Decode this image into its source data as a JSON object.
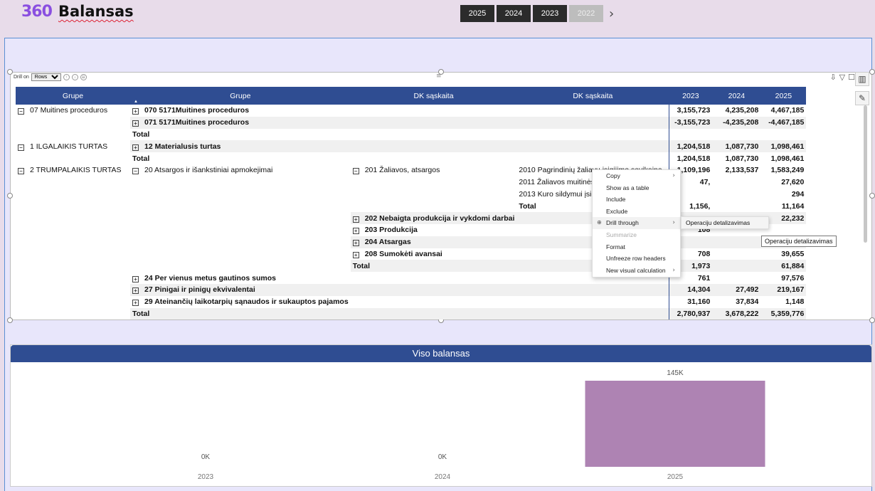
{
  "header": {
    "logo": "360",
    "title": "Balansas",
    "years": [
      {
        "label": "2025",
        "state": "active"
      },
      {
        "label": "2024",
        "state": "active"
      },
      {
        "label": "2023",
        "state": "active"
      },
      {
        "label": "2022",
        "state": "disabled"
      }
    ]
  },
  "drill": {
    "label": "Drill on",
    "value": "Rows"
  },
  "matrix": {
    "columns": [
      "Grupe",
      "Grupe",
      "DK sąskaita",
      "DK sąskaita",
      "2023",
      "2024",
      "2025"
    ],
    "rows": [
      {
        "c1": "07 Muitines proceduros",
        "c1pm": "−",
        "c2": "070 5171Muitines proceduros",
        "c2pm": "+",
        "c2b": true,
        "c3": "",
        "c4": "",
        "v1": "3,155,723",
        "v2": "4,235,208",
        "v3": "4,467,185",
        "band": false
      },
      {
        "c1": "",
        "c2": "071 5171Muitines proceduros",
        "c2pm": "+",
        "c2b": true,
        "c3": "",
        "c4": "",
        "v1": "-3,155,723",
        "v2": "-4,235,208",
        "v3": "-4,467,185",
        "band": true
      },
      {
        "c1": "",
        "c2": "Total",
        "c2b": true,
        "c3": "",
        "c4": "",
        "v1": "",
        "v2": "",
        "v3": "",
        "band": false
      },
      {
        "c1": "1 ILGALAIKIS TURTAS",
        "c1pm": "−",
        "c2": "12 Materialusis turtas",
        "c2pm": "+",
        "c2b": true,
        "c3": "",
        "c4": "",
        "v1": "1,204,518",
        "v2": "1,087,730",
        "v3": "1,098,461",
        "band": true
      },
      {
        "c1": "",
        "c2": "Total",
        "c2b": true,
        "c3": "",
        "c4": "",
        "v1": "1,204,518",
        "v2": "1,087,730",
        "v3": "1,098,461",
        "band": false
      },
      {
        "c1": "2 TRUMPALAIKIS TURTAS",
        "c1pm": "−",
        "c2": "20 Atsargos ir išankstiniai apmokejimai",
        "c2pm": "−",
        "c2b": false,
        "c3": "201 Žaliavos, atsargos",
        "c3pm": "−",
        "c4": "2010 Pagrindinių žaliavų įsigijimo savikaina",
        "v1": "1,109,196",
        "v2": "2,133,537",
        "v3": "1,583,249",
        "band": false,
        "c4band": true
      },
      {
        "c1": "",
        "c2": "",
        "c3": "",
        "c4": "2011 Žaliavos muitinės sandelis",
        "v1": "47,",
        "v2": "",
        "v3": "27,620",
        "band": false
      },
      {
        "c1": "",
        "c2": "",
        "c3": "",
        "c4": "2013 Kuro sildymui įsigyjimo savikaina",
        "v1": "",
        "v2": "",
        "v3": "294",
        "band": false,
        "c4band": true
      },
      {
        "c1": "",
        "c2": "",
        "c3": "",
        "c4": "Total",
        "c4b": true,
        "v1": "1,156,",
        "v2": "",
        "v3": "11,164",
        "band": false
      },
      {
        "c1": "",
        "c2": "",
        "c3": "202 Nebaigta produkcija ir vykdomi darbai",
        "c3pm": "+",
        "c3b": true,
        "c4": "",
        "v1": "",
        "v2": "",
        "v3": "22,232",
        "band": true
      },
      {
        "c1": "",
        "c2": "",
        "c3": "203 Produkcija",
        "c3pm": "+",
        "c3b": true,
        "c4": "",
        "v1": "108",
        "v2": "",
        "v3": "",
        "band": false
      },
      {
        "c1": "",
        "c2": "",
        "c3": "204 Atsargas",
        "c3pm": "+",
        "c3b": true,
        "c4": "",
        "v1": "",
        "v2": "",
        "v3": "215",
        "band": true
      },
      {
        "c1": "",
        "c2": "",
        "c3": "208 Sumokėti avansai",
        "c3pm": "+",
        "c3b": true,
        "c4": "",
        "v1": "708",
        "v2": "",
        "v3": "39,655",
        "band": false
      },
      {
        "c1": "",
        "c2": "",
        "c3": "Total",
        "c3b": true,
        "c4": "",
        "v1": "1,973",
        "v2": "",
        "v3": "61,884",
        "band": true
      },
      {
        "c1": "",
        "c2": "24 Per vienus metus gautinos sumos",
        "c2pm": "+",
        "c2b": true,
        "c3": "",
        "c4": "",
        "v1": "761",
        "v2": "",
        "v3": "97,576",
        "band": false
      },
      {
        "c1": "",
        "c2": "27 Pinigai ir pinigų ekvivalentai",
        "c2pm": "+",
        "c2b": true,
        "c3": "",
        "c4": "",
        "v1": "14,304",
        "v2": "27,492",
        "v3": "219,167",
        "band": true
      },
      {
        "c1": "",
        "c2": "29 Ateinančių laikotarpių sąnaudos ir sukauptos pajamos",
        "c2pm": "+",
        "c2b": true,
        "c3": "",
        "c4": "",
        "v1": "31,160",
        "v2": "37,834",
        "v3": "1,148",
        "band": false
      },
      {
        "c1": "",
        "c2": "Total",
        "c2b": true,
        "c3": "",
        "c4": "",
        "v1": "2,780,937",
        "v2": "3,678,222",
        "v3": "5,359,776",
        "band": true
      }
    ]
  },
  "context_menu": {
    "items": [
      {
        "label": "Copy",
        "submenu": true,
        "disabled": false
      },
      {
        "label": "Show as a table",
        "submenu": false,
        "disabled": false
      },
      {
        "label": "Include",
        "submenu": false,
        "disabled": false
      },
      {
        "label": "Exclude",
        "submenu": false,
        "disabled": false
      },
      {
        "label": "Drill through",
        "submenu": true,
        "disabled": false,
        "active": true,
        "icon": "drill-icon"
      },
      {
        "label": "Summarize",
        "submenu": false,
        "disabled": true
      },
      {
        "label": "Format",
        "submenu": false,
        "disabled": false
      },
      {
        "label": "Unfreeze row headers",
        "submenu": false,
        "disabled": false
      },
      {
        "label": "New visual calculation",
        "submenu": true,
        "disabled": false
      }
    ],
    "submenu_item": "Operaciju detalizavimas",
    "tooltip": "Operaciju detalizavimas"
  },
  "chart": {
    "title": "Viso balansas",
    "chart_data": {
      "type": "bar",
      "categories": [
        "2023",
        "2024",
        "2025"
      ],
      "values": [
        0,
        0,
        145000
      ],
      "data_labels": [
        "0K",
        "0K",
        "145K"
      ],
      "ylim": [
        0,
        145000
      ],
      "grid": false,
      "colors": {
        "bar": "#ae83b3"
      }
    }
  },
  "colors": {
    "header_blue": "#2f4d92",
    "accent_purple": "#8a4fe0",
    "background": "#e8dcea"
  }
}
